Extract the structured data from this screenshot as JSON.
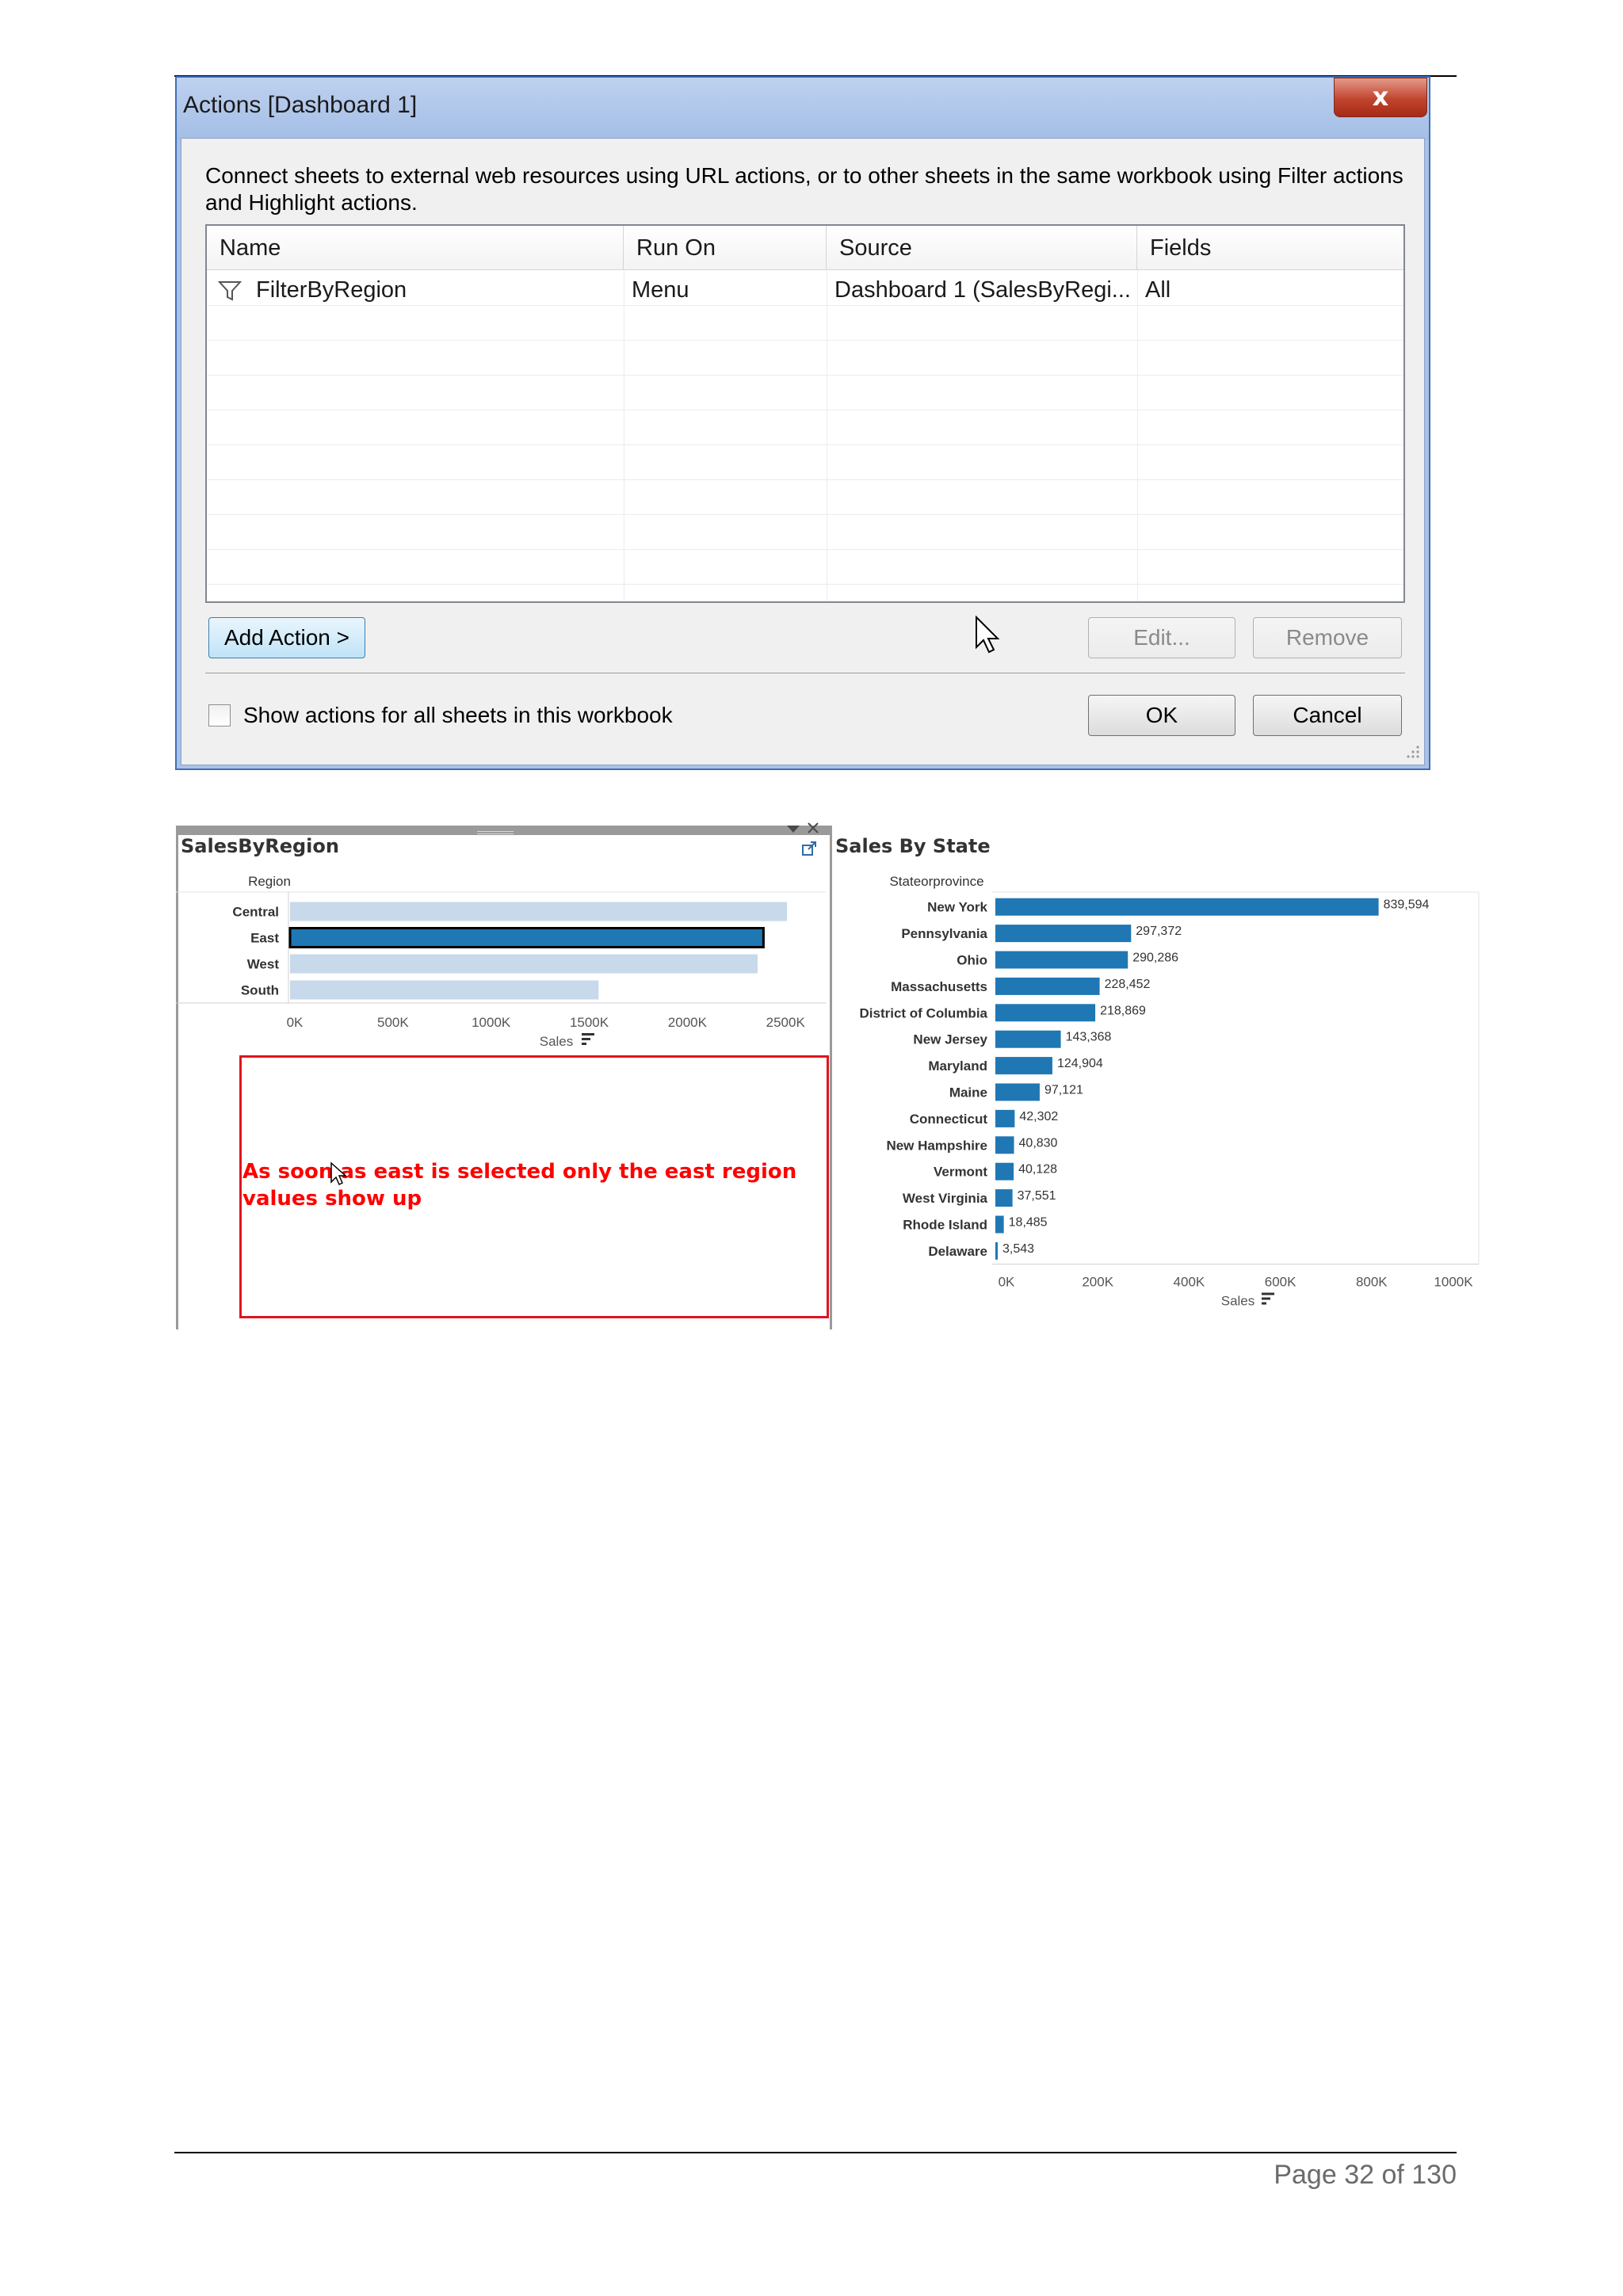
{
  "dialog": {
    "title": "Actions [Dashboard 1]",
    "close_glyph": "x",
    "description": "Connect sheets to external web resources using URL actions, or to other sheets in the same workbook using Filter actions and Highlight actions.",
    "columns": [
      "Name",
      "Run On",
      "Source",
      "Fields"
    ],
    "rows": [
      {
        "icon": "filter-icon",
        "name": "FilterByRegion",
        "run_on": "Menu",
        "source": "Dashboard 1 (SalesByRegi...",
        "fields": "All"
      }
    ],
    "add_action_label": "Add Action >",
    "edit_label": "Edit...",
    "remove_label": "Remove",
    "show_all_label": "Show actions for all sheets in this workbook",
    "show_all_checked": false,
    "ok_label": "OK",
    "cancel_label": "Cancel"
  },
  "region_sheet": {
    "title": "SalesByRegion",
    "note": "As soon as east is selected only the east region values show up"
  },
  "state_sheet": {
    "title": "Sales By State"
  },
  "chart_data": [
    {
      "type": "bar",
      "orientation": "horizontal",
      "row_header": "Region",
      "xlabel": "Sales",
      "categories": [
        "Central",
        "East",
        "West",
        "South"
      ],
      "values": [
        2540000,
        2420000,
        2390000,
        1580000
      ],
      "selected": "East",
      "selected_color": "#1f77b4",
      "dimmed_color": "#c7d9ea",
      "xlim": [
        0,
        2600000
      ],
      "ticks": [
        "0K",
        "500K",
        "1000K",
        "1500K",
        "2000K",
        "2500K"
      ]
    },
    {
      "type": "bar",
      "orientation": "horizontal",
      "row_header": "Stateorprovince",
      "xlabel": "Sales",
      "categories": [
        "New York",
        "Pennsylvania",
        "Ohio",
        "Massachusetts",
        "District of Columbia",
        "New Jersey",
        "Maryland",
        "Maine",
        "Connecticut",
        "New Hampshire",
        "Vermont",
        "West Virginia",
        "Rhode Island",
        "Delaware"
      ],
      "values": [
        839594,
        297372,
        290286,
        228452,
        218869,
        143368,
        124904,
        97121,
        42302,
        40830,
        40128,
        37551,
        18485,
        3543
      ],
      "labels": [
        "839,594",
        "297,372",
        "290,286",
        "228,452",
        "218,869",
        "143,368",
        "124,904",
        "97,121",
        "42,302",
        "40,830",
        "40,128",
        "37,551",
        "18,485",
        "3,543"
      ],
      "bar_color": "#1f77b4",
      "xlim": [
        0,
        1000000
      ],
      "ticks": [
        "0K",
        "200K",
        "400K",
        "600K",
        "800K",
        "1000K"
      ]
    }
  ],
  "footer": {
    "page_label": "Page 32 of 130"
  }
}
